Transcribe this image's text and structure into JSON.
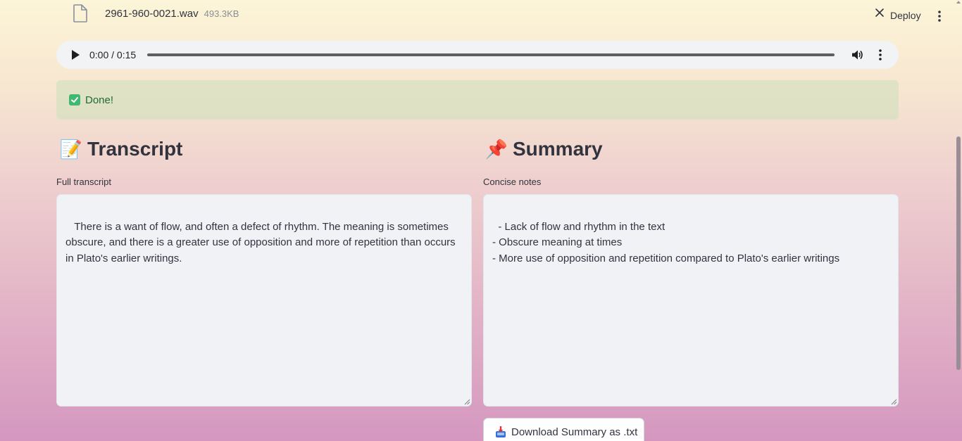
{
  "file": {
    "name": "2961-960-0021.wav",
    "size": "493.3KB",
    "icon": "file-icon"
  },
  "header": {
    "deploy_label": "Deploy",
    "close_icon": "close-icon",
    "menu_icon": "kebab-menu-icon"
  },
  "audio": {
    "time": "0:00 / 0:15",
    "progress": 0,
    "icons": [
      "play-icon",
      "volume-icon",
      "kebab-menu-icon"
    ]
  },
  "alert": {
    "text": "Done!",
    "icon": "check-icon",
    "color": "#3fb872"
  },
  "transcript": {
    "emoji": "📝",
    "title": "Transcript",
    "label": "Full transcript",
    "value": " There is a want of flow, and often a defect of rhythm. The meaning is sometimes obscure, and there is a greater use of opposition and more of repetition than occurs in Plato's earlier writings."
  },
  "summary": {
    "emoji": "📌",
    "title": "Summary",
    "label": "Concise notes",
    "value": "- Lack of flow and rhythm in the text\n- Obscure meaning at times\n- More use of opposition and repetition compared to Plato's earlier writings",
    "download_label": "Download Summary as .txt",
    "download_icon": "inbox-tray-icon"
  }
}
